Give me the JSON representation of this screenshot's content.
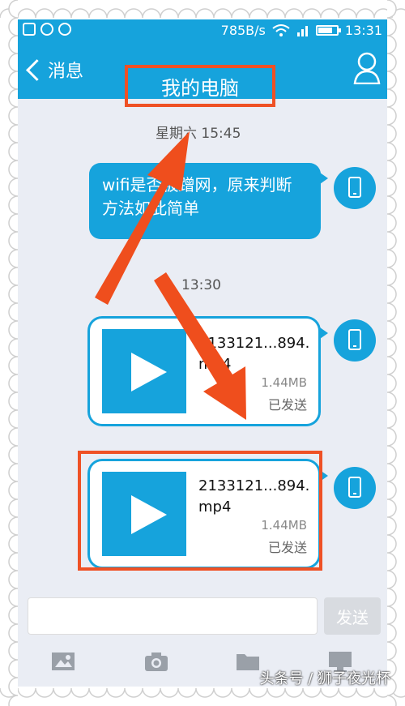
{
  "status_bar": {
    "speed": "785B/s",
    "clock": "13:31",
    "battery_level": 0.75
  },
  "header": {
    "back_label": "消息",
    "title": "我的电脑"
  },
  "messages": [
    {
      "time": "星期六 15:45",
      "type": "text",
      "text": "wifi是否被蹭网，原来判断方法如此简单"
    },
    {
      "time": "13:30",
      "type": "file",
      "filename": "2133121...894.mp4",
      "size": "1.44MB",
      "status": "已发送"
    },
    {
      "type": "file",
      "filename": "2133121...894.mp4",
      "size": "1.44MB",
      "status": "已发送"
    }
  ],
  "composer": {
    "send_label": "发送"
  },
  "toolbar": {
    "icons": [
      "image-icon",
      "camera-icon",
      "folder-icon",
      "computer-icon"
    ]
  },
  "watermark": "头条号 / 狮子夜光杯",
  "colors": {
    "accent": "#16a3dc",
    "highlight": "#ef5125",
    "background": "#eaedf4"
  }
}
